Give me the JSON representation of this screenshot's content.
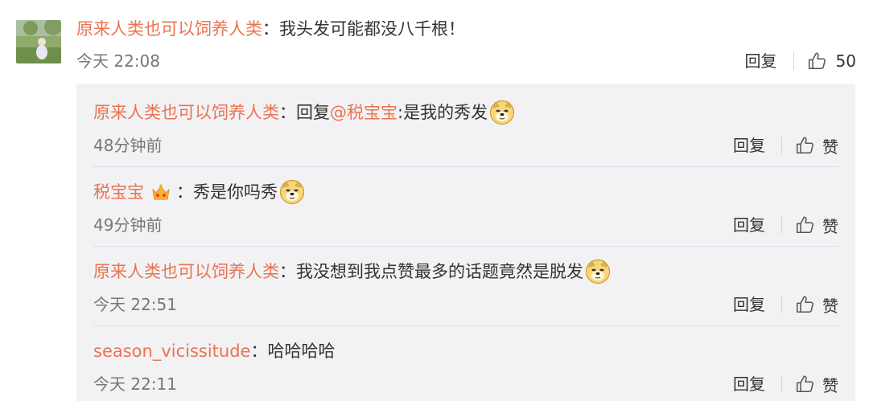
{
  "main_comment": {
    "username": "原来人类也可以饲养人类",
    "colon": "：",
    "text": "我头发可能都没八千根！",
    "time": "今天 22:08",
    "reply_label": "回复",
    "like_count": "50",
    "avatar_icon": "user-avatar-photo"
  },
  "replies": [
    {
      "username": "原来人类也可以饲养人类",
      "colon": "：",
      "reply_prefix": "回复",
      "mention": "@税宝宝",
      "text": ":是我的秀发",
      "emoji": "doge-emoji",
      "time": "48分钟前",
      "reply_label": "回复",
      "like_label": "赞"
    },
    {
      "username": "税宝宝",
      "badge": "crown-vip-badge",
      "colon": "：",
      "text": "秀是你吗秀",
      "emoji": "doge-emoji",
      "time": "49分钟前",
      "reply_label": "回复",
      "like_label": "赞"
    },
    {
      "username": "原来人类也可以饲养人类",
      "colon": "：",
      "text": "我没想到我点赞最多的话题竟然是脱发",
      "emoji": "doge-emoji",
      "time": "今天 22:51",
      "reply_label": "回复",
      "like_label": "赞"
    },
    {
      "username": "season_vicissitude",
      "colon": "：",
      "text": "哈哈哈哈",
      "time": "今天 22:11",
      "reply_label": "回复",
      "like_label": "赞"
    }
  ],
  "colors": {
    "username": "#eb7350",
    "text": "#333333",
    "meta": "#777777",
    "reply_bg": "#f2f2f5",
    "divider": "#dedee2"
  }
}
